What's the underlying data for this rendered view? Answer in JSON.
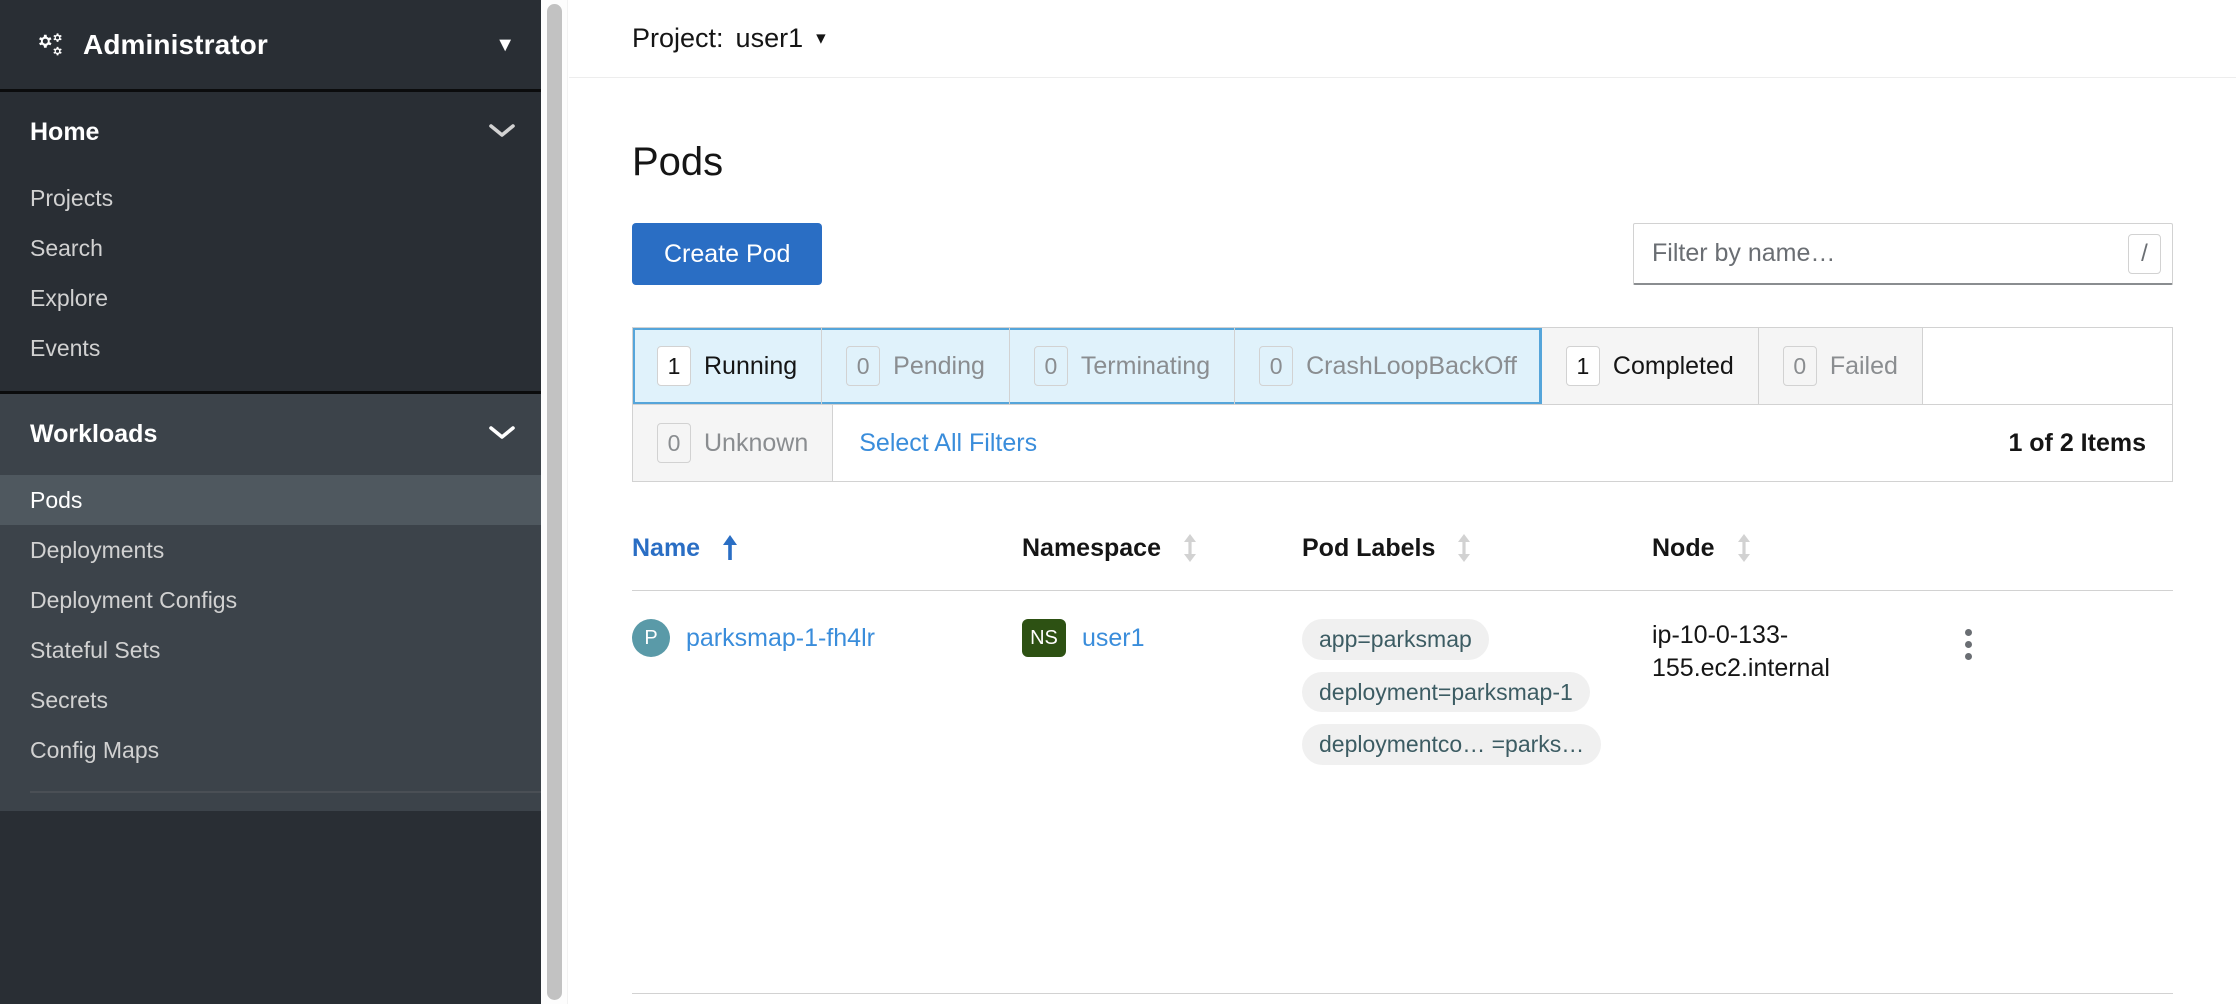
{
  "sidebar": {
    "perspective": {
      "label": "Administrator",
      "icon": "cogs-icon",
      "caret": "▼"
    },
    "sections": [
      {
        "title": "Home",
        "chevron": "⌄",
        "active": false,
        "items": [
          {
            "label": "Projects",
            "selected": false
          },
          {
            "label": "Search",
            "selected": false
          },
          {
            "label": "Explore",
            "selected": false
          },
          {
            "label": "Events",
            "selected": false
          }
        ]
      },
      {
        "title": "Workloads",
        "chevron": "⌄",
        "active": true,
        "items": [
          {
            "label": "Pods",
            "selected": true
          },
          {
            "label": "Deployments",
            "selected": false
          },
          {
            "label": "Deployment Configs",
            "selected": false
          },
          {
            "label": "Stateful Sets",
            "selected": false
          },
          {
            "label": "Secrets",
            "selected": false
          },
          {
            "label": "Config Maps",
            "selected": false
          }
        ]
      }
    ]
  },
  "header": {
    "project_prefix": "Project:",
    "project_name": "user1",
    "caret": "▾"
  },
  "page": {
    "title": "Pods"
  },
  "toolbar": {
    "create_label": "Create Pod",
    "filter_placeholder": "Filter by name…",
    "filter_value": "",
    "kbd_shortcut": "/"
  },
  "status_filters": {
    "row1": [
      {
        "count": "1",
        "label": "Running",
        "selected": true,
        "highlight": true
      },
      {
        "count": "0",
        "label": "Pending",
        "selected": true,
        "highlight": false
      },
      {
        "count": "0",
        "label": "Terminating",
        "selected": true,
        "highlight": false
      },
      {
        "count": "0",
        "label": "CrashLoopBackOff",
        "selected": true,
        "highlight": false
      },
      {
        "count": "1",
        "label": "Completed",
        "selected": false,
        "highlight": true
      },
      {
        "count": "0",
        "label": "Failed",
        "selected": false,
        "highlight": false
      }
    ],
    "row2": [
      {
        "count": "0",
        "label": "Unknown",
        "selected": false,
        "highlight": false
      }
    ],
    "select_all_label": "Select All Filters",
    "item_count": "1 of 2 Items"
  },
  "table": {
    "columns": [
      {
        "label": "Name",
        "sort": "asc"
      },
      {
        "label": "Namespace",
        "sort": "none"
      },
      {
        "label": "Pod Labels",
        "sort": "none"
      },
      {
        "label": "Node",
        "sort": "none"
      }
    ],
    "rows": [
      {
        "name_badge": "P",
        "name": "parksmap-1-fh4lr",
        "namespace_badge": "NS",
        "namespace": "user1",
        "labels": [
          "app=parksmap",
          "deployment=parksmap-1",
          "deploymentco… =parks…"
        ],
        "node": "ip-10-0-133-155.ec2.internal"
      }
    ]
  },
  "colors": {
    "sidebar_bg": "#292e34",
    "sidebar_active_section": "#3c434a",
    "sidebar_selected_item": "#4f585f",
    "primary_blue": "#2a6ec4",
    "link_blue": "#3a8ddb",
    "filter_selected_bg": "#e0f2fb",
    "filter_selected_border": "#55a5da",
    "pod_badge": "#5a9aa8",
    "ns_badge": "#2d5113",
    "label_pill_bg": "#f0f0f0",
    "label_pill_text": "#3c5c63"
  }
}
